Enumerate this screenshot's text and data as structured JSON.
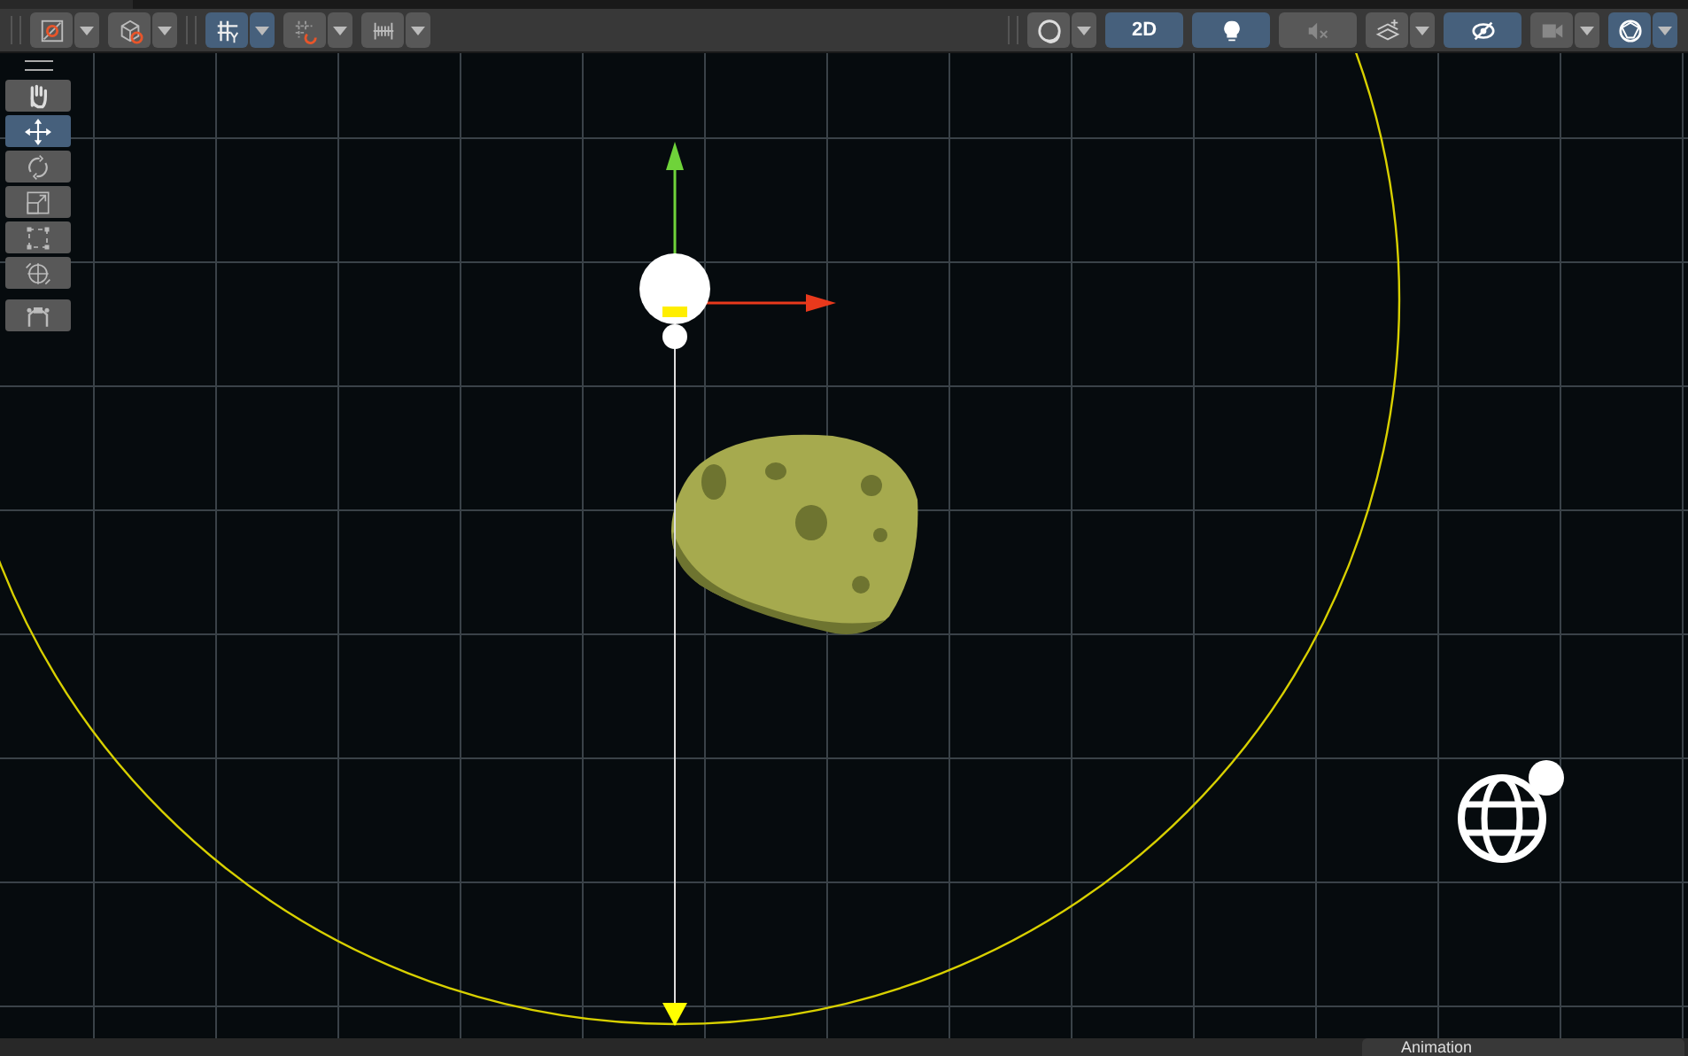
{
  "toolbar": {
    "left_buttons": [
      {
        "selected": false,
        "dropdown": true
      },
      {
        "selected": false,
        "dropdown": true
      },
      {
        "selected": true,
        "dropdown": true
      },
      {
        "selected": false,
        "dropdown": true
      },
      {
        "selected": false,
        "dropdown": true
      }
    ],
    "mode_label": "2D",
    "mode_selected": true,
    "right_buttons": [
      {
        "selected": false,
        "dropdown": true
      },
      {
        "selected": true,
        "dropdown": false
      },
      {
        "selected": false,
        "dropdown": false
      },
      {
        "selected": false,
        "dropdown": true
      },
      {
        "selected": true,
        "dropdown": false
      },
      {
        "selected": false,
        "dropdown": true
      },
      {
        "selected": true,
        "dropdown": true
      }
    ]
  },
  "tools": [
    {
      "selected": false
    },
    {
      "selected": true
    },
    {
      "selected": false
    },
    {
      "selected": false
    },
    {
      "selected": false
    },
    {
      "selected": false
    },
    {
      "selected": false
    }
  ],
  "bottom_bar": {
    "tab_label": "Animation"
  }
}
